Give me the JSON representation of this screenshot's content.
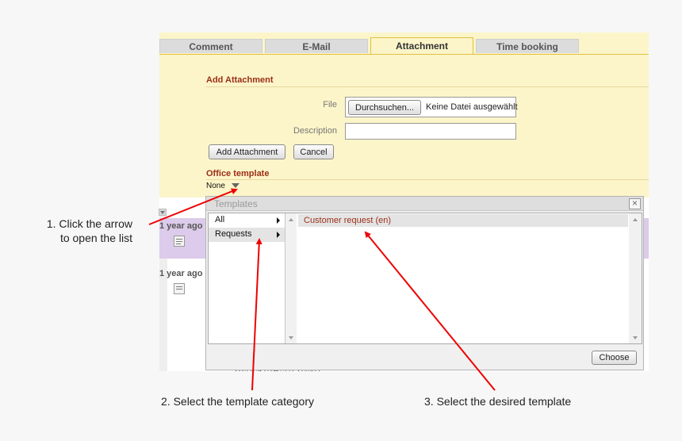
{
  "tabs": [
    {
      "label": "Comment",
      "active": false
    },
    {
      "label": "E-Mail",
      "active": false
    },
    {
      "label": "Attachment",
      "active": true
    },
    {
      "label": "Time booking",
      "active": false
    }
  ],
  "form": {
    "title": "Add Attachment",
    "file_label": "File",
    "browse_label": "Durchsuchen...",
    "no_file_text": "Keine Datei ausgewählt",
    "description_label": "Description",
    "description_value": "",
    "add_button": "Add Attachment",
    "cancel_button": "Cancel"
  },
  "office_template": {
    "title": "Office template",
    "selected": "None"
  },
  "list": {
    "rows": [
      {
        "time": "1 year ago"
      },
      {
        "time": "1 year ago"
      }
    ],
    "footer_text": "Consult Software GmbH"
  },
  "dialog": {
    "title": "Templates",
    "categories": [
      {
        "label": "All"
      },
      {
        "label": "Requests"
      }
    ],
    "templates": [
      {
        "label": "Customer request (en)"
      }
    ],
    "choose_button": "Choose"
  },
  "annotations": {
    "step1_line1": "1. Click the arrow",
    "step1_line2": "to open the list",
    "step2": "2. Select the template category",
    "step3": "3. Select the desired template"
  },
  "colors": {
    "panel_bg": "#fcf5c9",
    "section_title": "#9b2f17",
    "arrow_red": "#ee0000",
    "highlight_row": "#dccbea"
  }
}
